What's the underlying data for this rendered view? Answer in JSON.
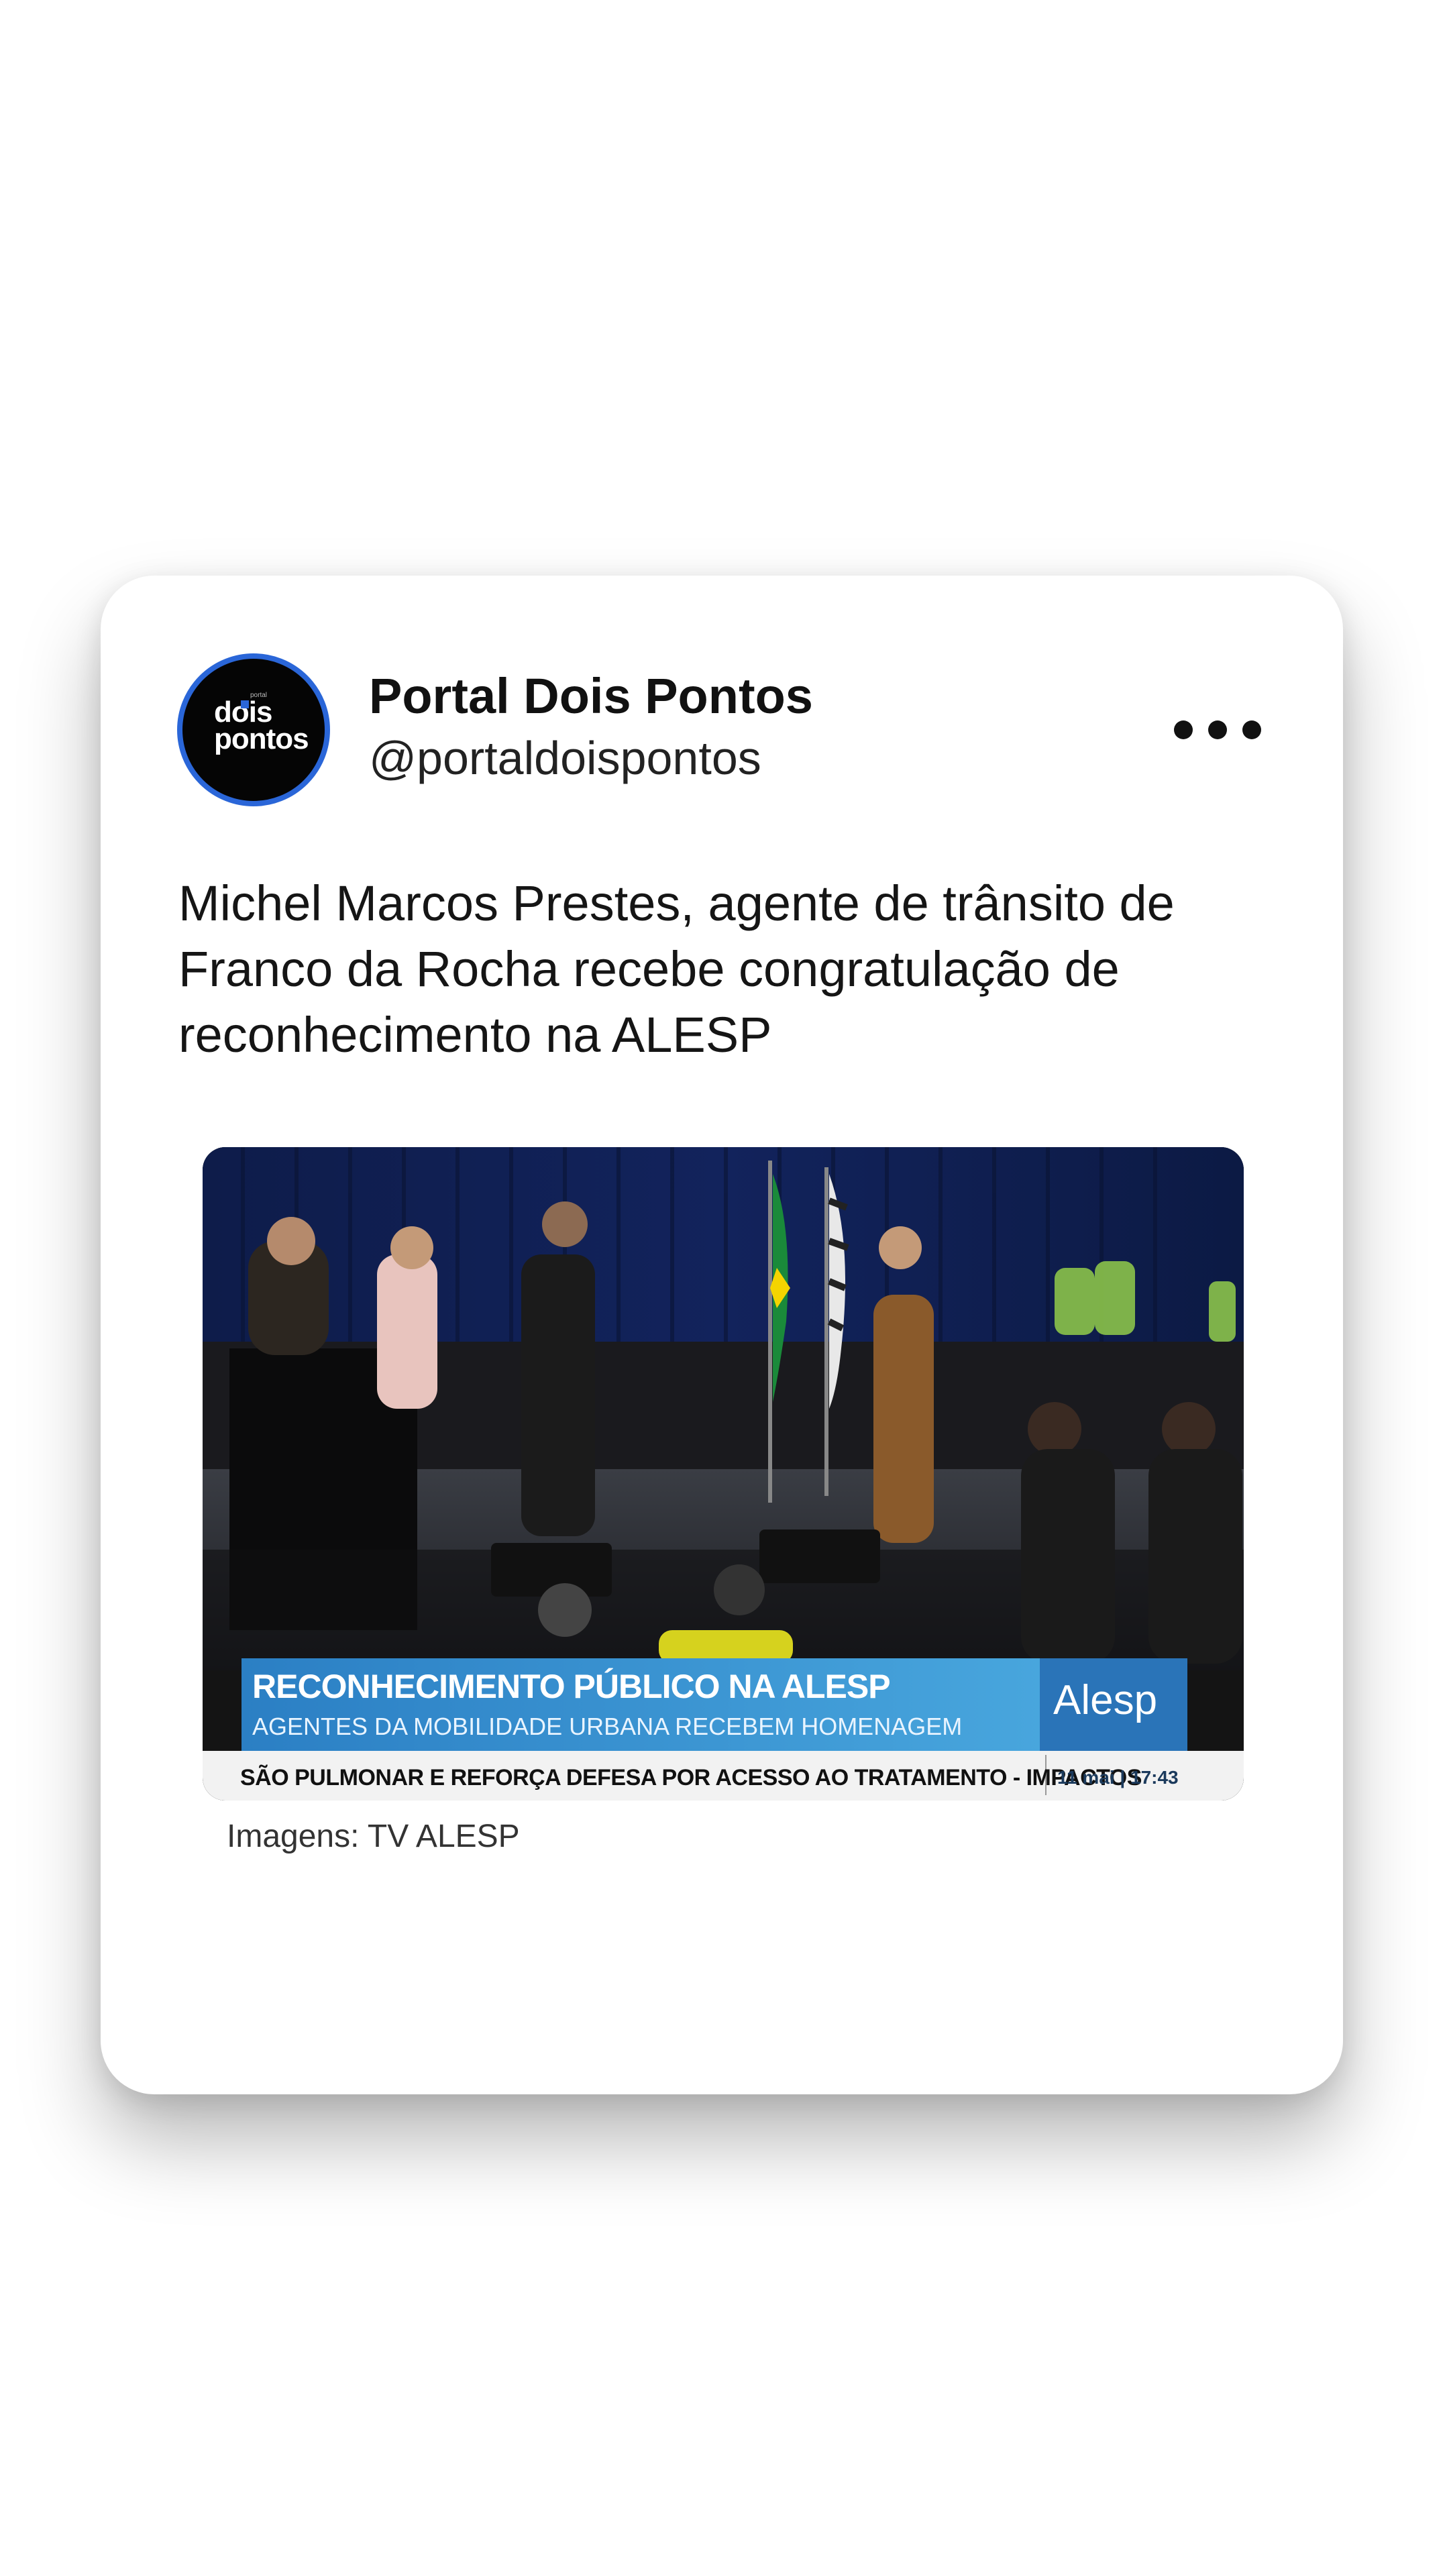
{
  "post": {
    "author_name": "Portal Dois Pontos",
    "author_handle": "@portaldoispontos",
    "avatar_logo_top": "dois",
    "avatar_logo_bottom": "pontos",
    "avatar_logo_tiny": "portal",
    "text": "Michel Marcos Prestes, agente de trânsito de Franco da Rocha recebe congratulação de reconhecimento na ALESP",
    "image_caption": "Imagens: TV ALESP",
    "more_icon": "more-horizontal-icon"
  },
  "video": {
    "lower_third_title": "RECONHECIMENTO PÚBLICO  NA ALESP",
    "lower_third_subtitle": "AGENTES DA MOBILIDADE URBANA RECEBEM HOMENAGEM",
    "ticker": "SÃO PULMONAR E REFORÇA DEFESA POR ACESSO AO TRATAMENTO - IMPACTOS",
    "date_time": "11 mai  |  17:43",
    "channel_logo": "Alesp"
  },
  "colors": {
    "avatar_ring": "#2a66d8",
    "lower_third": "#2f8fc9",
    "card_background": "#ffffff"
  }
}
